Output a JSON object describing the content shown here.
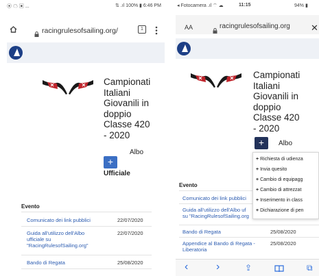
{
  "left": {
    "status": {
      "left_icons": "⦿ ☁ ▣ ...",
      "right": "⇅ .ıl 100% ▮ 6:46 PM"
    },
    "url": "racingrulesofsailing.org/",
    "tab_count": "1",
    "menu_dots": "⋮",
    "title": "Campionati\nItaliani\nGiovanili in\ndoppio\nClasse 420\n- 2020",
    "plus_label": "+",
    "albo_label": "Albo",
    "ufficiale_label": "Ufficiale",
    "table": {
      "header": "Evento",
      "rows": [
        {
          "event": "Comunicato dei link pubblici",
          "date": "22/07/2020"
        },
        {
          "event": "Guida all'utilizzo dell'Albo\nufficiale su\n\"RacingRulesofSailing.org\"",
          "date": "22/07/2020"
        },
        {
          "event": "Bando di Regata",
          "date": "25/08/2020"
        }
      ]
    }
  },
  "right": {
    "status": {
      "carrier": "◂ Fotocamera .ıl ⌔ ☁",
      "time": "11:15",
      "battery": "94% ▮"
    },
    "aa_label": "AA",
    "url": "racingrulesofsailing.org",
    "close": "✕",
    "title": "Campionati\nItaliani\nGiovanili in\ndoppio\nClasse 420\n- 2020",
    "plus_label": "+",
    "albo_label": "Albo",
    "menu": [
      "Richiesta di udienza",
      "Invia quesito",
      "Cambio di equipagg",
      "Cambio di attrezzat",
      "Inserimento in class",
      "Dichiarazione di pen"
    ],
    "table": {
      "header": "Evento",
      "rows": [
        {
          "event": "Comunicato dei link pubblici",
          "date": ""
        },
        {
          "event": "Guida all'utilizzo dell'Albo uf\nsu \"RacingRulesofSailing.org",
          "date": ""
        },
        {
          "event": "Bando di Regata",
          "date": "25/08/2020"
        },
        {
          "event": "Appendice al Bando di Regata -\nLiberatoria",
          "date": "25/08/2020"
        }
      ]
    },
    "bottom_bar": {
      "back": "‹",
      "forward": "›",
      "share": "⇪",
      "bookmarks": "📖",
      "tabs": "⧉"
    }
  },
  "colors": {
    "link": "#2b5bb0",
    "button": "#3b6fc4",
    "button_dark": "#22325a",
    "logo": "#1d3f86",
    "ios_accent": "#2f6fdd"
  },
  "icons": [
    "home-icon",
    "lock-icon",
    "tab-switcher-icon",
    "overflow-menu-icon",
    "site-logo-icon",
    "flags-icon",
    "close-icon",
    "back-icon",
    "forward-icon",
    "share-icon",
    "bookmarks-icon",
    "tabs-icon"
  ]
}
